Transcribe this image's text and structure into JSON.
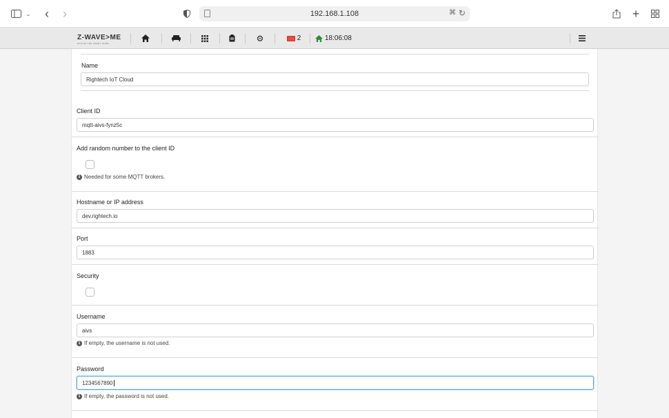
{
  "browser": {
    "url": "192.168.1.108"
  },
  "app": {
    "logo": "Z-WAVE>ME",
    "logo_tagline": "EVOLVE THE SMART HOME",
    "alerts_count": "2",
    "time": "18:06:08"
  },
  "form": {
    "name": {
      "label": "Name",
      "value": "Rightech IoT Cloud"
    },
    "client_id": {
      "label": "Client ID",
      "value": "mqtt-aivs-fynz5c"
    },
    "random_number": {
      "label": "Add random number to the client ID",
      "hint": "Needed for some MQTT brokers."
    },
    "hostname": {
      "label": "Hostname or IP address",
      "value": "dev.rightech.io"
    },
    "port": {
      "label": "Port",
      "value": "1883"
    },
    "security": {
      "label": "Security"
    },
    "username": {
      "label": "Username",
      "value": "aivs",
      "hint": "If empty, the username is not used."
    },
    "password": {
      "label": "Password",
      "value": "1234567890",
      "hint": "If empty, the password is not used."
    }
  }
}
